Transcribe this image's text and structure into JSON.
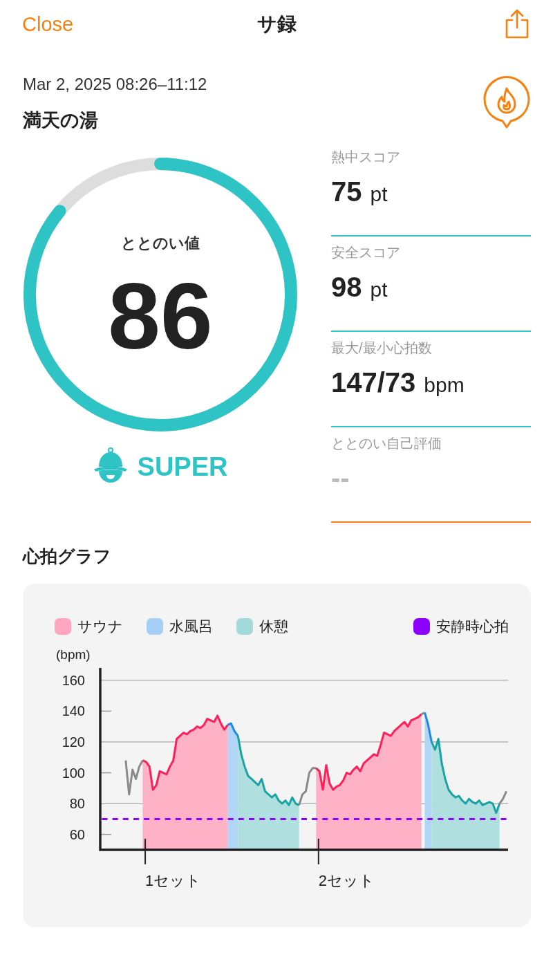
{
  "header": {
    "close": "Close",
    "title": "サ録"
  },
  "session": {
    "datetime": "Mar 2, 2025 08:26–11:12",
    "venue": "満天の湯"
  },
  "gauge": {
    "label": "ととのい値",
    "value": "86",
    "level": 0.86,
    "rank": "SUPER"
  },
  "stats": [
    {
      "kind": "score",
      "label": "熱中スコア",
      "value": "75",
      "unit": "pt"
    },
    {
      "kind": "score",
      "label": "安全スコア",
      "value": "98",
      "unit": "pt"
    },
    {
      "kind": "score",
      "label": "最大/最小心拍数",
      "value": "147/73",
      "unit": "bpm"
    },
    {
      "kind": "unrated",
      "label": "ととのい自己評価",
      "value": "--"
    }
  ],
  "heart_graph": {
    "title": "心拍グラフ",
    "chart_data": {
      "type": "line",
      "ylabel": "(bpm)",
      "ylim": [
        50,
        168
      ],
      "yticks": [
        60,
        80,
        100,
        120,
        140,
        160
      ],
      "grid": true,
      "categories": [
        null,
        null,
        null,
        null,
        null,
        null,
        null,
        null,
        null,
        null,
        null,
        null,
        null,
        null,
        null,
        null,
        null,
        null,
        null,
        null,
        null,
        "1セット",
        null,
        null,
        null,
        null,
        null,
        null,
        null,
        null,
        null,
        null,
        null,
        null,
        null,
        null,
        null,
        null,
        null,
        null,
        null,
        null,
        null,
        null,
        null,
        null,
        null,
        null,
        null,
        null,
        null,
        null,
        null,
        null,
        null,
        null,
        null,
        null,
        null,
        null,
        null,
        null,
        null,
        null,
        null,
        null,
        null,
        null,
        null,
        null,
        null,
        null,
        "2セット",
        null,
        null,
        null,
        null,
        null,
        null,
        null,
        null,
        null,
        null,
        null,
        null,
        null,
        null,
        null,
        null,
        null,
        null,
        null,
        null,
        null,
        null,
        null,
        null,
        null,
        null,
        null,
        null,
        null,
        null,
        null,
        null,
        null,
        null,
        null,
        null,
        null,
        null,
        null,
        null,
        null,
        null,
        null,
        null,
        null,
        null,
        null
      ],
      "series": [
        {
          "type": "line",
          "line_style": "solid",
          "color": "#8a8a8a",
          "values": [
            null,
            null,
            null,
            null,
            null,
            null,
            null,
            108,
            86,
            102,
            96,
            104,
            108,
            null,
            null,
            null,
            null,
            null,
            null,
            null,
            null,
            null,
            null,
            null,
            null,
            null,
            null,
            null,
            null,
            null,
            null,
            null,
            null,
            null,
            null,
            null,
            null,
            null,
            null,
            null,
            null,
            null,
            null,
            null,
            null,
            null,
            null,
            null,
            null,
            null,
            null,
            null,
            null,
            null,
            null,
            null,
            null,
            null,
            79,
            86,
            88,
            100,
            103,
            103,
            null,
            null,
            null,
            null,
            null,
            null,
            null,
            null,
            null,
            null,
            null,
            null,
            null,
            null,
            null,
            null,
            null,
            null,
            null,
            null,
            null,
            null,
            null,
            null,
            null,
            null,
            null,
            null,
            null,
            null,
            138,
            139,
            null,
            null,
            null,
            null,
            null,
            null,
            null,
            null,
            null,
            null,
            null,
            null,
            null,
            null,
            null,
            null,
            null,
            null,
            null,
            null,
            null,
            80,
            83,
            88
          ]
        },
        {
          "type": "area",
          "line_style": "solid",
          "name": "サウナ",
          "color": "#ff1f5a",
          "values": [
            null,
            null,
            null,
            null,
            null,
            null,
            null,
            null,
            null,
            null,
            null,
            null,
            108,
            107,
            104,
            89,
            92,
            101,
            100,
            99,
            104,
            108,
            122,
            124,
            126,
            125,
            127,
            128,
            130,
            129,
            131,
            135,
            134,
            133,
            137,
            132,
            128,
            131,
            null,
            null,
            null,
            null,
            null,
            null,
            null,
            null,
            null,
            null,
            null,
            null,
            null,
            null,
            null,
            null,
            null,
            null,
            null,
            null,
            null,
            null,
            null,
            null,
            null,
            103,
            101,
            89,
            105,
            93,
            89,
            91,
            92,
            95,
            100,
            99,
            102,
            104,
            101,
            106,
            108,
            110,
            112,
            111,
            118,
            126,
            125,
            124,
            127,
            129,
            131,
            133,
            130,
            134,
            135,
            136,
            138,
            null,
            null,
            null,
            null,
            null,
            null,
            null,
            null,
            null,
            null,
            null,
            null,
            null,
            null,
            null,
            null,
            null,
            null,
            null,
            null,
            null,
            null,
            null,
            null,
            null
          ]
        },
        {
          "type": "area",
          "line_style": "solid",
          "name": "水風呂",
          "color": "#1e88e5",
          "values": [
            null,
            null,
            null,
            null,
            null,
            null,
            null,
            null,
            null,
            null,
            null,
            null,
            null,
            null,
            null,
            null,
            null,
            null,
            null,
            null,
            null,
            null,
            null,
            null,
            null,
            null,
            null,
            null,
            null,
            null,
            null,
            null,
            null,
            null,
            null,
            null,
            null,
            131,
            132,
            127,
            124,
            null,
            null,
            null,
            null,
            null,
            null,
            null,
            null,
            null,
            null,
            null,
            null,
            null,
            null,
            null,
            null,
            null,
            null,
            null,
            null,
            null,
            null,
            null,
            null,
            null,
            null,
            null,
            null,
            null,
            null,
            null,
            null,
            null,
            null,
            null,
            null,
            null,
            null,
            null,
            null,
            null,
            null,
            null,
            null,
            null,
            null,
            null,
            null,
            null,
            null,
            null,
            null,
            null,
            null,
            139,
            131,
            120,
            null,
            null,
            null,
            null,
            null,
            null,
            null,
            null,
            null,
            null,
            null,
            null,
            null,
            null,
            null,
            null,
            null,
            null,
            null,
            null,
            null,
            null
          ]
        },
        {
          "type": "area",
          "line_style": "solid",
          "name": "休憩",
          "color": "#1aa3a3",
          "values": [
            null,
            null,
            null,
            null,
            null,
            null,
            null,
            null,
            null,
            null,
            null,
            null,
            null,
            null,
            null,
            null,
            null,
            null,
            null,
            null,
            null,
            null,
            null,
            null,
            null,
            null,
            null,
            null,
            null,
            null,
            null,
            null,
            null,
            null,
            null,
            null,
            null,
            null,
            null,
            null,
            124,
            112,
            104,
            98,
            96,
            94,
            92,
            96,
            88,
            86,
            84,
            86,
            82,
            80,
            82,
            79,
            84,
            80,
            79,
            null,
            null,
            null,
            null,
            null,
            null,
            null,
            null,
            null,
            null,
            null,
            null,
            null,
            null,
            null,
            null,
            null,
            null,
            null,
            null,
            null,
            null,
            null,
            null,
            null,
            null,
            null,
            null,
            null,
            null,
            null,
            null,
            null,
            null,
            null,
            null,
            null,
            null,
            120,
            115,
            122,
            106,
            96,
            89,
            86,
            84,
            85,
            82,
            80,
            83,
            81,
            80,
            82,
            79,
            80,
            81,
            80,
            74,
            80,
            null,
            null
          ]
        },
        {
          "type": "line",
          "line_style": "dashed",
          "name": "安静時心拍",
          "color": "#8b00ff",
          "values": [
            70,
            70,
            70,
            70,
            70,
            70,
            70,
            70,
            70,
            70,
            70,
            70,
            70,
            70,
            70,
            70,
            70,
            70,
            70,
            70,
            70,
            70,
            70,
            70,
            70,
            70,
            70,
            70,
            70,
            70,
            70,
            70,
            70,
            70,
            70,
            70,
            70,
            70,
            70,
            70,
            70,
            70,
            70,
            70,
            70,
            70,
            70,
            70,
            70,
            70,
            70,
            70,
            70,
            70,
            70,
            70,
            70,
            70,
            70,
            70,
            70,
            70,
            70,
            70,
            70,
            70,
            70,
            70,
            70,
            70,
            70,
            70,
            70,
            70,
            70,
            70,
            70,
            70,
            70,
            70,
            70,
            70,
            70,
            70,
            70,
            70,
            70,
            70,
            70,
            70,
            70,
            70,
            70,
            70,
            70,
            70,
            70,
            70,
            70,
            70,
            70,
            70,
            70,
            70,
            70,
            70,
            70,
            70,
            70,
            70,
            70,
            70,
            70,
            70,
            70,
            70,
            70,
            70,
            70,
            70
          ]
        }
      ]
    }
  }
}
